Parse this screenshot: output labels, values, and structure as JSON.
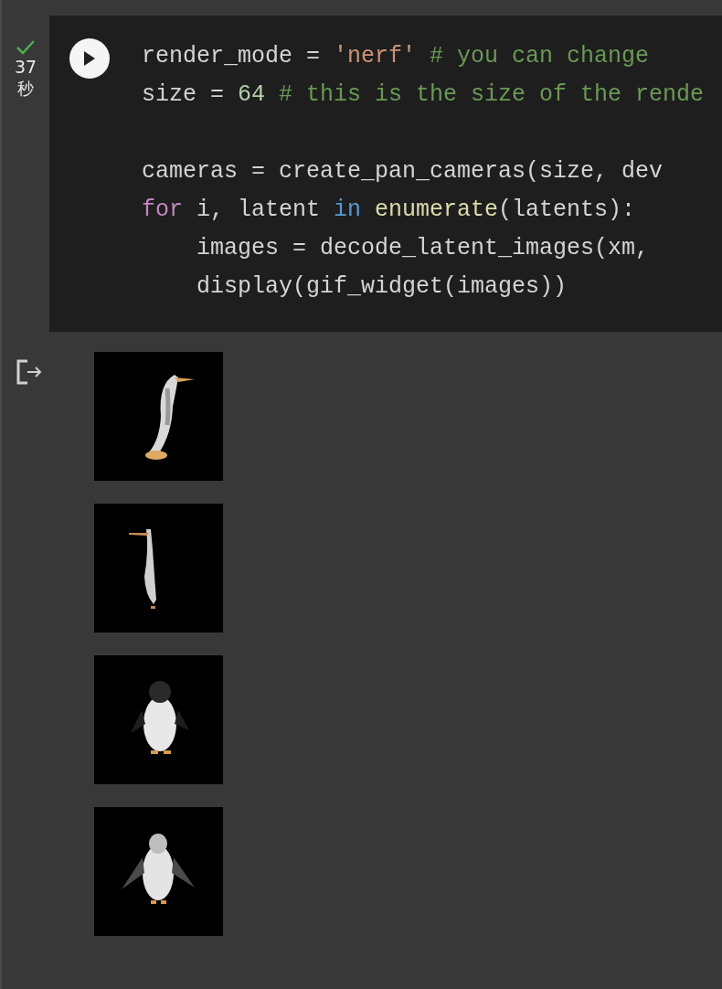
{
  "cell": {
    "status": {
      "done": true,
      "duration": "37",
      "unit": "秒"
    },
    "code_lines": [
      {
        "indent": false,
        "blank_before": false,
        "tokens": [
          {
            "kind": "plain",
            "text": "render_mode = "
          },
          {
            "kind": "string",
            "text": "'nerf'"
          },
          {
            "kind": "comment",
            "text": " # you can change"
          }
        ]
      },
      {
        "indent": false,
        "blank_before": false,
        "tokens": [
          {
            "kind": "plain",
            "text": "size = "
          },
          {
            "kind": "number",
            "text": "64"
          },
          {
            "kind": "comment",
            "text": " # this is the size of the rende"
          }
        ]
      },
      {
        "indent": false,
        "blank_before": true,
        "tokens": [
          {
            "kind": "plain",
            "text": "cameras = create_pan_cameras(size, dev"
          }
        ]
      },
      {
        "indent": false,
        "blank_before": false,
        "tokens": [
          {
            "kind": "keyword",
            "text": "for"
          },
          {
            "kind": "plain",
            "text": " i, latent "
          },
          {
            "kind": "operator",
            "text": "in"
          },
          {
            "kind": "builtin",
            "text": " enumerate"
          },
          {
            "kind": "plain",
            "text": "(latents):"
          }
        ]
      },
      {
        "indent": true,
        "blank_before": false,
        "tokens": [
          {
            "kind": "plain",
            "text": "images = decode_latent_images(xm,"
          }
        ]
      },
      {
        "indent": true,
        "blank_before": false,
        "tokens": [
          {
            "kind": "plain",
            "text": "display(gif_widget(images))"
          }
        ]
      }
    ]
  }
}
